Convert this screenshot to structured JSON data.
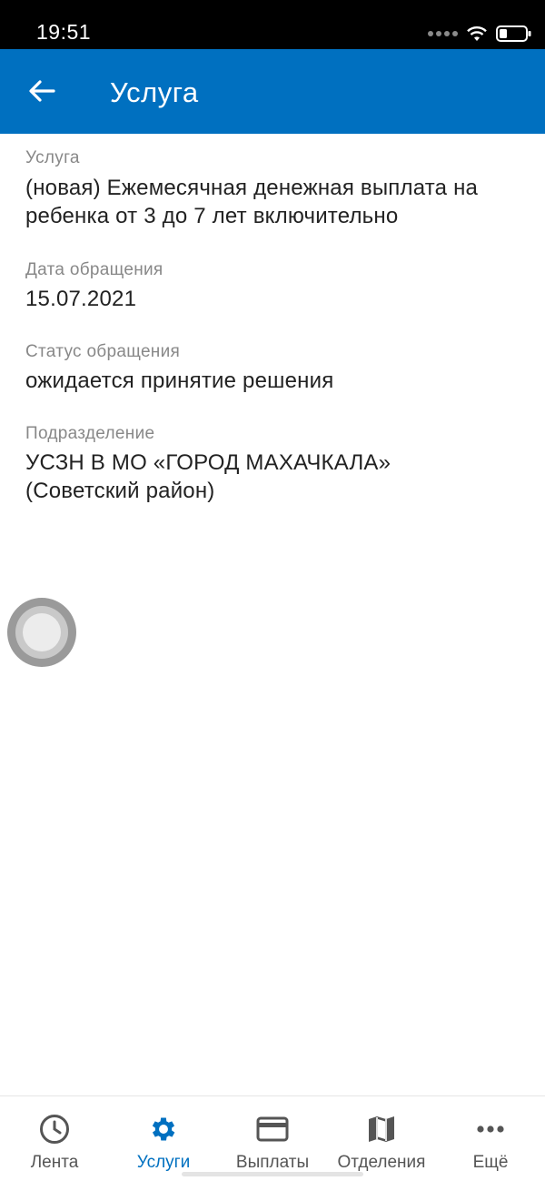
{
  "status_bar": {
    "time": "19:51"
  },
  "app_bar": {
    "title": "Услуга"
  },
  "fields": {
    "service": {
      "label": "Услуга",
      "value": "(новая) Ежемесячная денежная выплата на ребенка от 3 до 7 лет включительно"
    },
    "date": {
      "label": "Дата обращения",
      "value": "15.07.2021"
    },
    "status": {
      "label": "Статус обращения",
      "value": "ожидается принятие решения"
    },
    "department": {
      "label": "Подразделение",
      "value": "УСЗН  В МО «ГОРОД МАХАЧКАЛА» (Советский район)"
    }
  },
  "tabs": [
    {
      "label": "Лента",
      "icon": "clock-icon",
      "active": false
    },
    {
      "label": "Услуги",
      "icon": "gear-icon",
      "active": true
    },
    {
      "label": "Выплаты",
      "icon": "card-icon",
      "active": false
    },
    {
      "label": "Отделения",
      "icon": "map-icon",
      "active": false
    },
    {
      "label": "Ещё",
      "icon": "more-icon",
      "active": false
    }
  ],
  "colors": {
    "accent": "#0070c0",
    "text": "#222222",
    "label": "#888888"
  }
}
